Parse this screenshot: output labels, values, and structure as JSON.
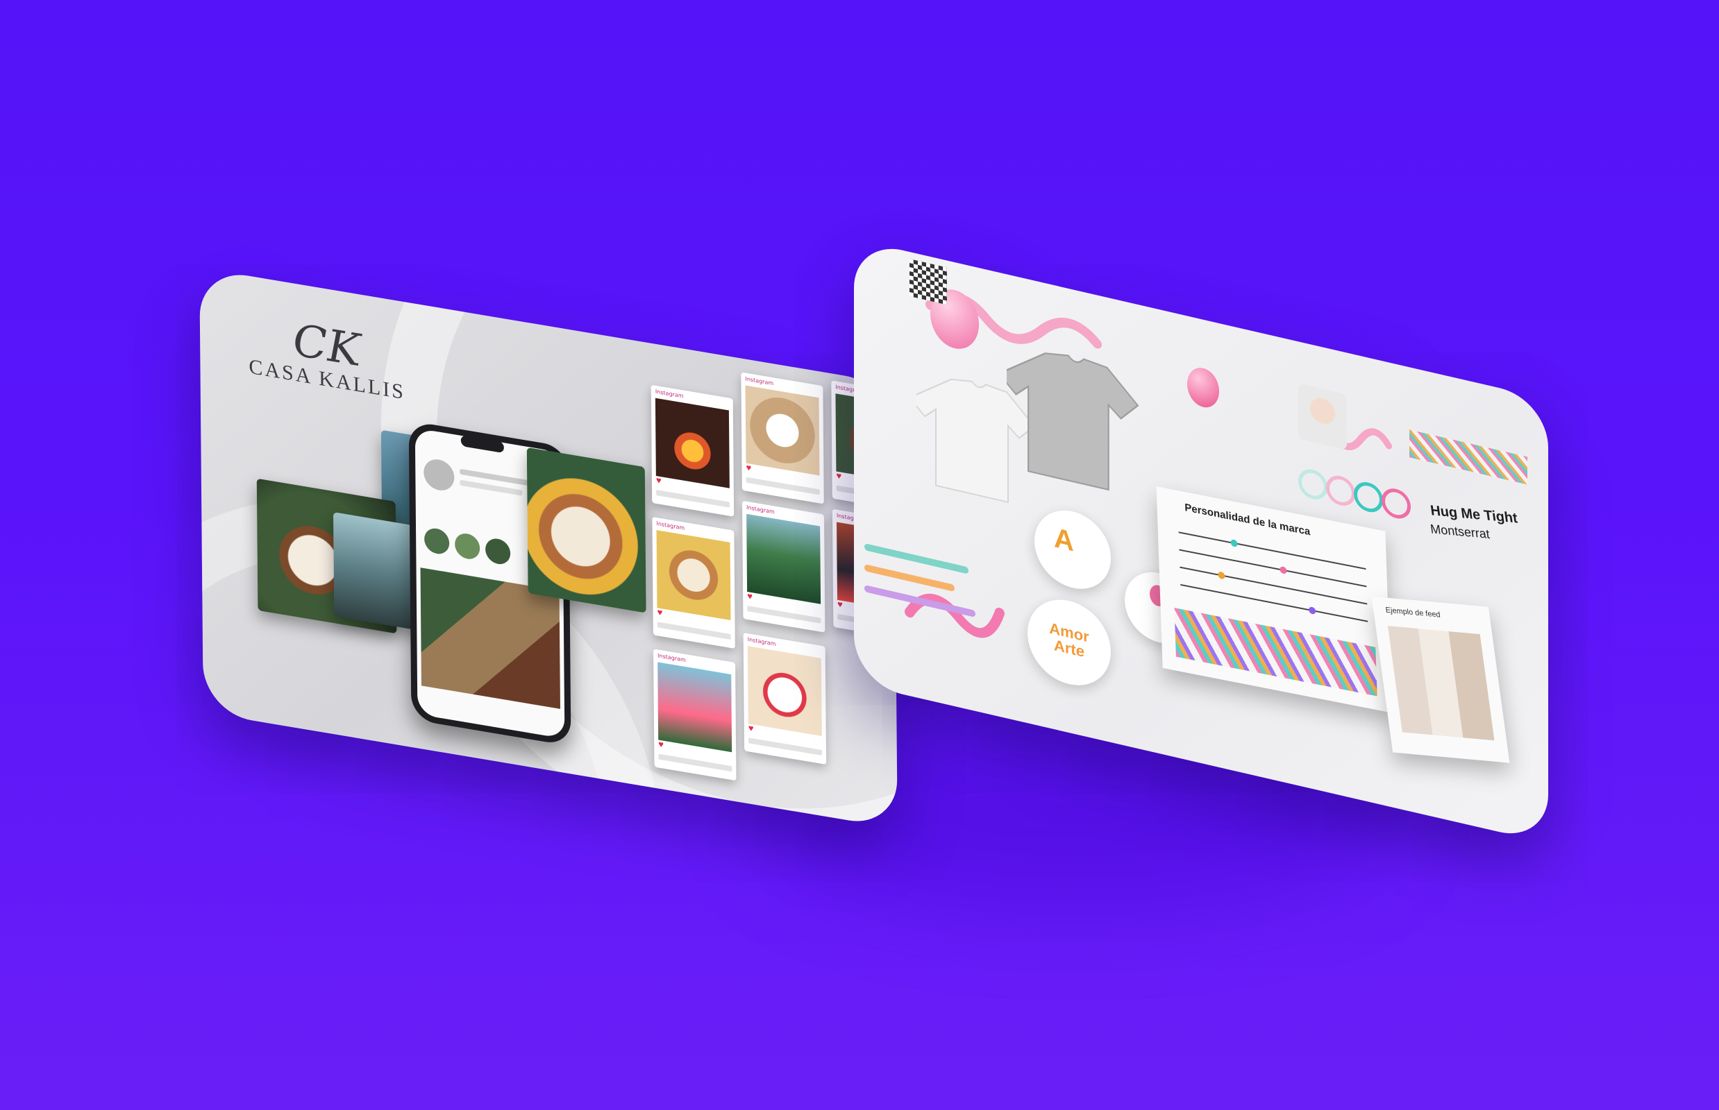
{
  "left_card": {
    "logo_monogram": "CK",
    "logo_name": "CASA KALLIS",
    "post_source_label": "Instagram"
  },
  "right_card": {
    "brochure_title": "Personalidad de la marca",
    "font_sample_1": "Hug Me Tight",
    "font_sample_2": "Montserrat",
    "badge_text": "Amor Arte",
    "brochure_2_title": "Ejemplo de feed"
  },
  "colors": {
    "background": "#5a14fa",
    "pink_accent": "#f07ab0",
    "teal_accent": "#3cc8c0"
  }
}
